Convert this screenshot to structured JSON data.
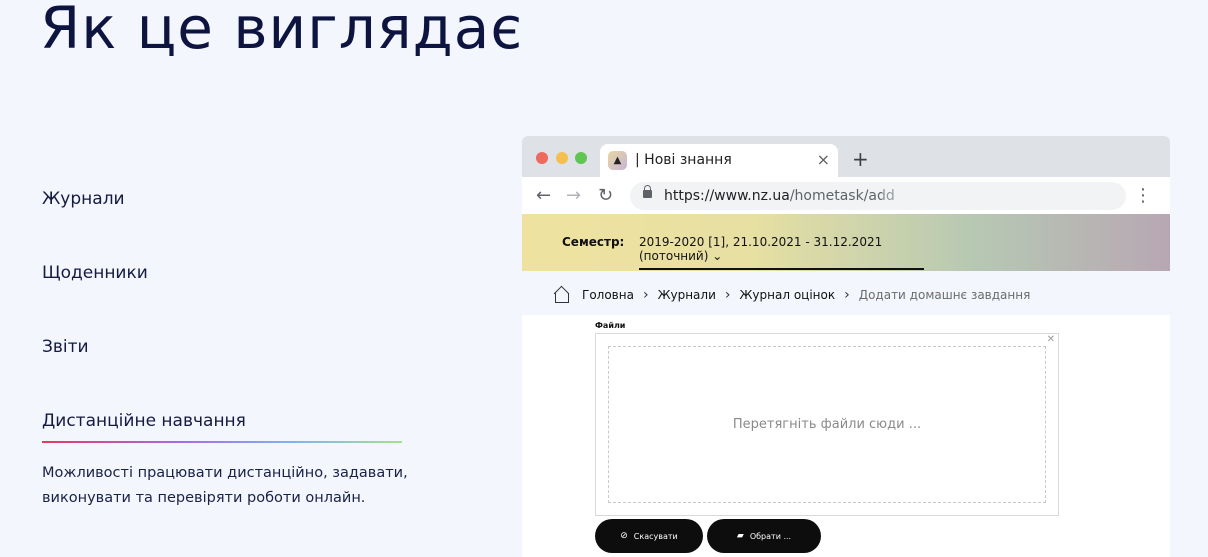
{
  "page": {
    "title": "Як це виглядає"
  },
  "features": {
    "items": [
      "Журнали",
      "Щоденники",
      "Звіти",
      "Дистанційне навчання"
    ],
    "active_description": "Можливості працювати дистанційно, задавати, виконувати та перевіряти роботи онлайн."
  },
  "browser": {
    "tab_title": "| Нові знання",
    "tab_close": "×",
    "new_tab": "+",
    "url_main": "https://www.nz.ua",
    "url_path": "/hometask/add",
    "semester_label": "Семестр:",
    "semester_value": "2019-2020 [1], 21.10.2021 - 31.12.2021 (поточний)",
    "breadcrumb": {
      "home": "Головна",
      "journals": "Журнали",
      "grades_journal": "Журнал оцінок",
      "current": "Додати домашнє завдання"
    },
    "files_label": "Файли",
    "dropzone_text": "Перетягніть файли сюди ...",
    "cancel_button": "Скасувати",
    "choose_button": "Обрати ..."
  },
  "colors": {
    "background": "#f4f6fd",
    "title": "#0d1440",
    "button": "#0d0d0d"
  }
}
